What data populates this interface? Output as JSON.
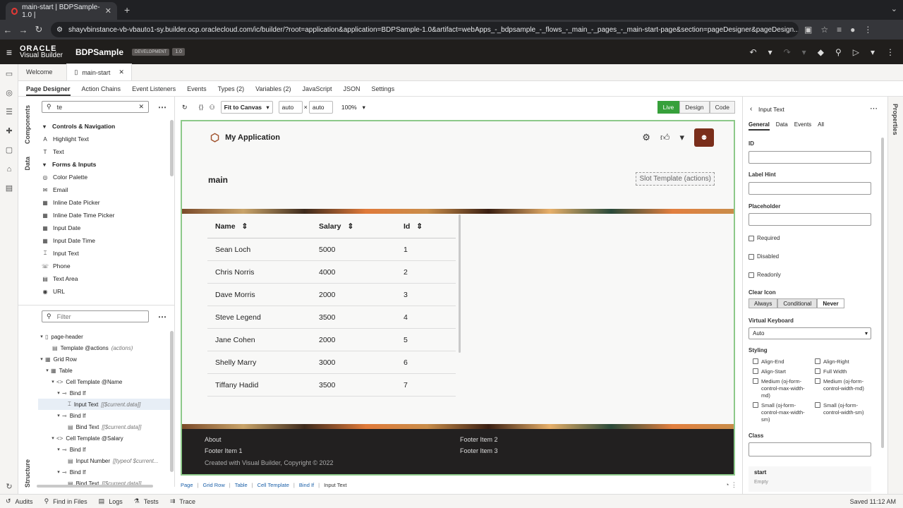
{
  "browser": {
    "tab_title": "main-start | BDPSample-1.0 |",
    "new_tab": "+",
    "url": "shayvbinstance-vb-vbauto1-sy.builder.ocp.oraclecloud.com/ic/builder/?root=application&application=BDPSample-1.0&artifact=webApps_-_bdpsample_-_flows_-_main_-_pages_-_main-start-page&section=pageDesigner&pageDesign..."
  },
  "vb": {
    "logo_line1": "ORACLE",
    "logo_line2": "Visual Builder",
    "app_name": "BDPSample",
    "badge": "DEVELOPMENT",
    "version": "1.0"
  },
  "doc_tabs": [
    "Welcome",
    "main-start"
  ],
  "sub_tabs": [
    "Page Designer",
    "Action Chains",
    "Event Listeners",
    "Events",
    "Types (2)",
    "Variables (2)",
    "JavaScript",
    "JSON",
    "Settings"
  ],
  "left_rail": {
    "components": "Components",
    "data": "Data",
    "structure": "Structure"
  },
  "components": {
    "search_value": "te",
    "items": [
      {
        "label": "Controls & Navigation",
        "group": true,
        "icon": "▾"
      },
      {
        "label": "Highlight Text",
        "icon": "A"
      },
      {
        "label": "Text",
        "icon": "T"
      },
      {
        "label": "Forms & Inputs",
        "group": true,
        "icon": "▾"
      },
      {
        "label": "Color Palette",
        "icon": "◎"
      },
      {
        "label": "Email",
        "icon": "✉"
      },
      {
        "label": "Inline Date Picker",
        "icon": "▦"
      },
      {
        "label": "Inline Date Time Picker",
        "icon": "▦"
      },
      {
        "label": "Input Date",
        "icon": "▦"
      },
      {
        "label": "Input Date Time",
        "icon": "▦"
      },
      {
        "label": "Input Text",
        "icon": "⌶"
      },
      {
        "label": "Phone",
        "icon": "☏"
      },
      {
        "label": "Text Area",
        "icon": "▤"
      },
      {
        "label": "URL",
        "icon": "◉"
      }
    ]
  },
  "structure": {
    "filter_placeholder": "Filter",
    "nodes": [
      {
        "label": "page-header",
        "arrow": "▾",
        "icon": "▯",
        "dim": ""
      },
      {
        "label": "Template @actions",
        "arrow": "",
        "icon": "▤",
        "dim": "(actions)"
      },
      {
        "label": "Grid Row",
        "arrow": "▾",
        "icon": "▦",
        "dim": ""
      },
      {
        "label": "Table",
        "arrow": "▾",
        "icon": "▦",
        "dim": ""
      },
      {
        "label": "Cell Template @Name",
        "arrow": "▾",
        "icon": "<>",
        "dim": ""
      },
      {
        "label": "Bind If",
        "arrow": "▾",
        "icon": "⊸",
        "dim": ""
      },
      {
        "label": "Input Text",
        "arrow": "",
        "icon": "⌶",
        "dim": "[[$current.data]]",
        "sel": true
      },
      {
        "label": "Bind If",
        "arrow": "▾",
        "icon": "⊸",
        "dim": ""
      },
      {
        "label": "Bind Text",
        "arrow": "",
        "icon": "▤",
        "dim": "[[$current.data]]"
      },
      {
        "label": "Cell Template @Salary",
        "arrow": "▾",
        "icon": "<>",
        "dim": ""
      },
      {
        "label": "Bind If",
        "arrow": "▾",
        "icon": "⊸",
        "dim": ""
      },
      {
        "label": "Input Number",
        "arrow": "",
        "icon": "▤",
        "dim": "[[typeof $current..."
      },
      {
        "label": "Bind If",
        "arrow": "▾",
        "icon": "⊸",
        "dim": ""
      },
      {
        "label": "Bind Text",
        "arrow": "",
        "icon": "▤",
        "dim": "[[$current.data]]"
      }
    ]
  },
  "toolbar": {
    "fit": "Fit to Canvas",
    "w": "auto",
    "h": "auto",
    "zoom": "100%",
    "modes": [
      "Live",
      "Design",
      "Code"
    ]
  },
  "app": {
    "title": "My Application",
    "page_title": "main",
    "slot": "Slot Template (actions)",
    "columns": [
      "Name",
      "Salary",
      "Id"
    ],
    "rows": [
      [
        "Sean Loch",
        "5000",
        "1"
      ],
      [
        "Chris Norris",
        "4000",
        "2"
      ],
      [
        "Dave Morris",
        "2000",
        "3"
      ],
      [
        "Steve Legend",
        "3500",
        "4"
      ],
      [
        "Jane Cohen",
        "2000",
        "5"
      ],
      [
        "Shelly Marry",
        "3000",
        "6"
      ],
      [
        "Tiffany Hadid",
        "3500",
        "7"
      ]
    ],
    "footer": {
      "about": "About",
      "item1": "Footer Item 1",
      "item2": "Footer Item 2",
      "item3": "Footer Item 3",
      "copyright": "Created with Visual Builder, Copyright © 2022"
    }
  },
  "breadcrumb": [
    "Page",
    "Grid Row",
    "Table",
    "Cell Template",
    "Bind If",
    "Input Text"
  ],
  "props": {
    "title": "Input Text",
    "tabs": [
      "General",
      "Data",
      "Events",
      "All"
    ],
    "id_label": "ID",
    "label_hint": "Label Hint",
    "placeholder": "Placeholder",
    "required": "Required",
    "disabled": "Disabled",
    "readonly": "Readonly",
    "clear_icon": "Clear Icon",
    "clear_options": [
      "Always",
      "Conditional",
      "Never"
    ],
    "vk_label": "Virtual Keyboard",
    "vk_value": "Auto",
    "styling": "Styling",
    "styling_opts": [
      "Align-End",
      "Align-Right",
      "Align-Start",
      "Full Width",
      "Medium (oj-form-control-max-width-md)",
      "Medium (oj-form-control-width-md)",
      "Small (oj-form-control-max-width-sm)",
      "Small (oj-form-control-width-sm)"
    ],
    "class_label": "Class",
    "start": "start",
    "start_val": "Empty",
    "rail": "Properties"
  },
  "bottom": {
    "audits": "Audits",
    "find": "Find in Files",
    "logs": "Logs",
    "tests": "Tests",
    "trace": "Trace",
    "saved": "Saved 11:12 AM"
  }
}
